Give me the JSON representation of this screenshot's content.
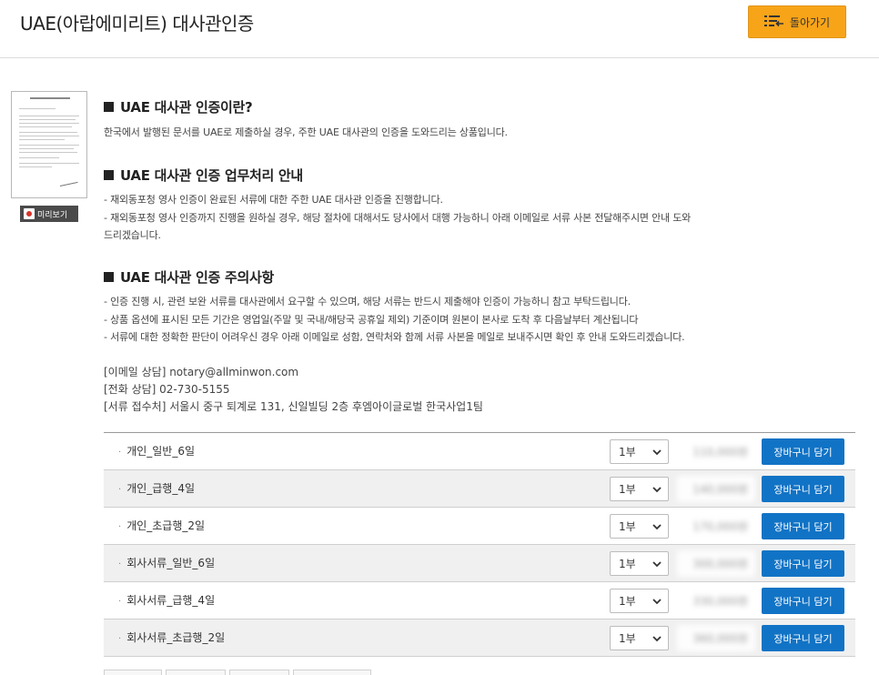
{
  "header": {
    "title": "UAE(아랍에미리트) 대사관인증",
    "back_label": "돌아가기"
  },
  "preview": {
    "label": "미리보기"
  },
  "sections": [
    {
      "heading": "UAE 대사관 인증이란?",
      "lines": [
        "한국에서 발행된 문서를 UAE로 제출하실 경우, 주한 UAE 대사관의 인증을 도와드리는 상품입니다."
      ]
    },
    {
      "heading": "UAE 대사관 인증 업무처리 안내",
      "lines": [
        "- 재외동포청 영사 인증이 완료된 서류에 대한 주한 UAE 대사관 인증을 진행합니다.",
        "- 재외동포청 영사 인증까지 진행을 원하실 경우, 해당 절차에 대해서도 당사에서 대행 가능하니 아래 이메일로 서류 사본 전달해주시면 안내 도와",
        "드리겠습니다."
      ]
    },
    {
      "heading": "UAE 대사관 인증 주의사항",
      "lines": [
        "- 인증 진행 시, 관련 보완 서류를 대사관에서 요구할 수 있으며, 해당 서류는 반드시 제출해야 인증이 가능하니 참고 부탁드립니다.",
        "- 상품 옵션에 표시된 모든 기간은 영업일(주말 및 국내/해당국 공휴일 제외) 기준이며 원본이 본사로 도착 후 다음날부터 계산됩니다",
        "- 서류에 대한 정확한 판단이 어려우신 경우 아래 이메일로 성함, 연락처와 함께 서류 사본을 메일로 보내주시면 확인 후 안내 도와드리겠습니다."
      ]
    }
  ],
  "contact": {
    "email": "[이메일 상담] notary@allminwon.com",
    "phone": "[전화 상담] 02-730-5155",
    "address": "[서류 접수처] 서울시 중구 퇴계로 131, 신일빌딩 2층 후엠아이글로벌 한국사업1팀"
  },
  "products": [
    {
      "name": "개인_일반_6일",
      "qty": "1부",
      "price": "110,000원",
      "cart": "장바구니 담기"
    },
    {
      "name": "개인_급행_4일",
      "qty": "1부",
      "price": "140,000원",
      "cart": "장바구니 담기"
    },
    {
      "name": "개인_초급행_2일",
      "qty": "1부",
      "price": "170,000원",
      "cart": "장바구니 담기"
    },
    {
      "name": "회사서류_일반_6일",
      "qty": "1부",
      "price": "300,000원",
      "cart": "장바구니 담기"
    },
    {
      "name": "회사서류_급행_4일",
      "qty": "1부",
      "price": "330,000원",
      "cart": "장바구니 담기"
    },
    {
      "name": "회사서류_초급행_2일",
      "qty": "1부",
      "price": "360,000원",
      "cart": "장바구니 담기"
    }
  ],
  "colors": {
    "accent": "#f7a419",
    "button_blue": "#1173c5"
  }
}
